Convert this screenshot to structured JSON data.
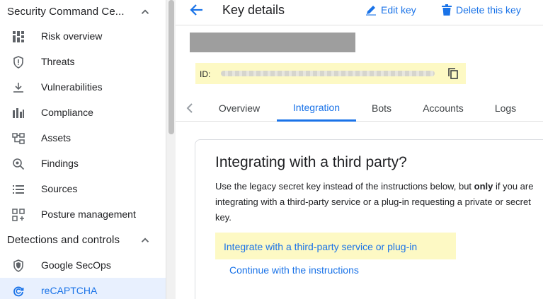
{
  "sidebar": {
    "section1": {
      "title": "Security Command Ce..."
    },
    "items1": [
      {
        "label": "Risk overview",
        "icon": "risk-overview-icon"
      },
      {
        "label": "Threats",
        "icon": "shield-icon"
      },
      {
        "label": "Vulnerabilities",
        "icon": "download-icon"
      },
      {
        "label": "Compliance",
        "icon": "bar-chart-icon"
      },
      {
        "label": "Assets",
        "icon": "assets-icon"
      },
      {
        "label": "Findings",
        "icon": "search-icon"
      },
      {
        "label": "Sources",
        "icon": "list-icon"
      },
      {
        "label": "Posture management",
        "icon": "grid-icon"
      }
    ],
    "section2": {
      "title": "Detections and controls"
    },
    "items2": [
      {
        "label": "Google SecOps",
        "icon": "secops-icon"
      },
      {
        "label": "reCAPTCHA",
        "icon": "recaptcha-icon"
      }
    ]
  },
  "header": {
    "title": "Key details",
    "edit_label": "Edit key",
    "delete_label": "Delete this key"
  },
  "key": {
    "id_label": "ID:"
  },
  "tabs": [
    {
      "label": "Overview"
    },
    {
      "label": "Integration"
    },
    {
      "label": "Bots"
    },
    {
      "label": "Accounts"
    },
    {
      "label": "Logs"
    }
  ],
  "card": {
    "title": "Integrating with a third party?",
    "body_before": "Use the legacy secret key instead of the instructions below, but ",
    "body_bold": "only",
    "body_after": " if you are integrating with a third-party service or a plug-in requesting a private or secret key.",
    "integrate_link": "Integrate with a third-party service or plug-in",
    "continue_link": "Continue with the instructions"
  },
  "colors": {
    "accent": "#1a73e8",
    "highlight": "#fdf9c4",
    "active_nav_bg": "#e8f0fe"
  }
}
